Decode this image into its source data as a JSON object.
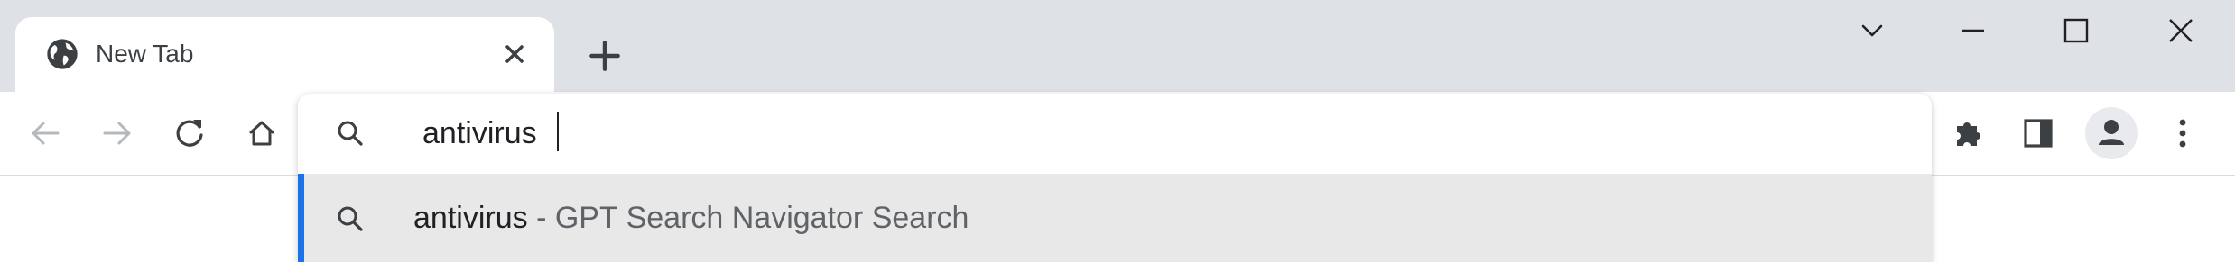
{
  "window": {
    "tab": {
      "title": "New Tab",
      "favicon": "globe-icon",
      "close_icon": "close-icon"
    },
    "new_tab_icon": "plus-icon",
    "controls": [
      "chevron-down-icon",
      "minimize-icon",
      "maximize-icon",
      "close-window-icon"
    ]
  },
  "toolbar": {
    "back_icon": "back-arrow-icon",
    "forward_icon": "forward-arrow-icon",
    "reload_icon": "reload-icon",
    "home_icon": "home-icon",
    "extensions_icon": "puzzle-icon",
    "side_panel_icon": "side-panel-icon",
    "profile_icon": "profile-icon",
    "menu_icon": "kebab-menu-icon"
  },
  "omnibox": {
    "value": "antivirus",
    "search_icon": "search-icon",
    "suggestions": [
      {
        "query": "antivirus",
        "separator": "-",
        "provider": "GPT Search Navigator Search",
        "icon": "search-icon"
      }
    ]
  },
  "colors": {
    "tabstrip_bg": "#dee1e6",
    "suggestion_bg": "#e8e8e8",
    "accent": "#1a73e8",
    "icon": "#5f6368"
  }
}
